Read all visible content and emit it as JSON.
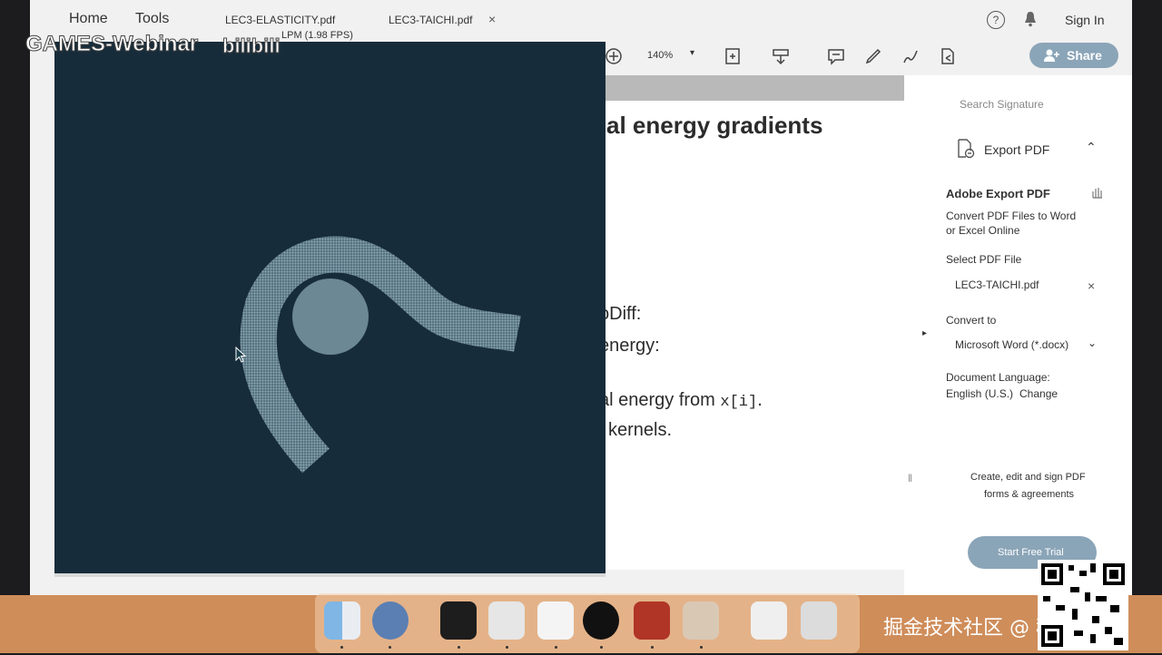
{
  "nav": {
    "home": "Home",
    "tools": "Tools"
  },
  "tabs": [
    {
      "label": "LEC3-ELASTICITY.pdf"
    },
    {
      "label": "LEC3-TAICHI.pdf"
    }
  ],
  "tab_close": "×",
  "header": {
    "help": "?",
    "signin": "Sign In"
  },
  "overlay": {
    "title": "LPM (1.98 FPS)",
    "watermark": "GAMES-Webinar",
    "logo": "bilibili"
  },
  "toolbar": {
    "zoom": "140%",
    "share": "Share"
  },
  "document": {
    "heading": "al energy gradients",
    "lines": [
      {
        "text": "oDiff:"
      },
      {
        "text": "energy:"
      },
      {
        "text": "al energy from ",
        "code": "x[i]",
        "tail": "."
      },
      {
        "text": "l kernels."
      }
    ]
  },
  "panel": {
    "search": "Search Signature",
    "export_title": "Export PDF",
    "adobe_title": "Adobe Export PDF",
    "desc_line1": "Convert PDF Files to Word",
    "desc_line2": "or Excel Online",
    "select_label": "Select PDF File",
    "file_name": "LEC3-TAICHI.pdf",
    "convert_label": "Convert to",
    "convert_value": "Microsoft Word (*.docx)",
    "lang_label": "Document Language:",
    "lang_value": "English (U.S.)",
    "lang_change": "Change",
    "promo_line1": "Create, edit and sign PDF",
    "promo_line2": "forms & agreements",
    "trial_button": "Start Free Trial"
  },
  "juejin_watermark": "掘金技术社区 @ 稀土掘金",
  "colors": {
    "sim_bg": "#172c3a",
    "particles": "#7f9aa6",
    "share": "#8ba5b8",
    "dock": "#cf8d5a"
  }
}
